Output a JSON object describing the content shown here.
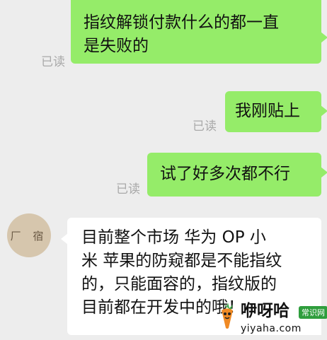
{
  "messages": [
    {
      "direction": "outgoing",
      "read_status": "已读",
      "lines": [
        "指纹解锁付款什么的都一直",
        "是失败的"
      ]
    },
    {
      "direction": "outgoing",
      "read_status": "已读",
      "lines": [
        "我刚贴上"
      ]
    },
    {
      "direction": "outgoing",
      "read_status": "已读",
      "lines": [
        "试了好多次都不行"
      ]
    },
    {
      "direction": "incoming",
      "sender_avatar_text": "厂 宿",
      "lines": [
        "目前整个市场 华为 OP 小",
        "米 苹果的防窥都是不能指纹",
        "的，只能面容的，指纹版的",
        "目前都在开发中的哦！"
      ]
    }
  ],
  "watermark": {
    "brand": "咿呀哈",
    "badge": "常识网",
    "url": "yiyaha.com"
  },
  "colors": {
    "background": "#ededed",
    "outgoing_bubble": "#95ec69",
    "incoming_bubble": "#ffffff",
    "read_status": "#a9a9a9",
    "badge": "#2f9e3d"
  }
}
